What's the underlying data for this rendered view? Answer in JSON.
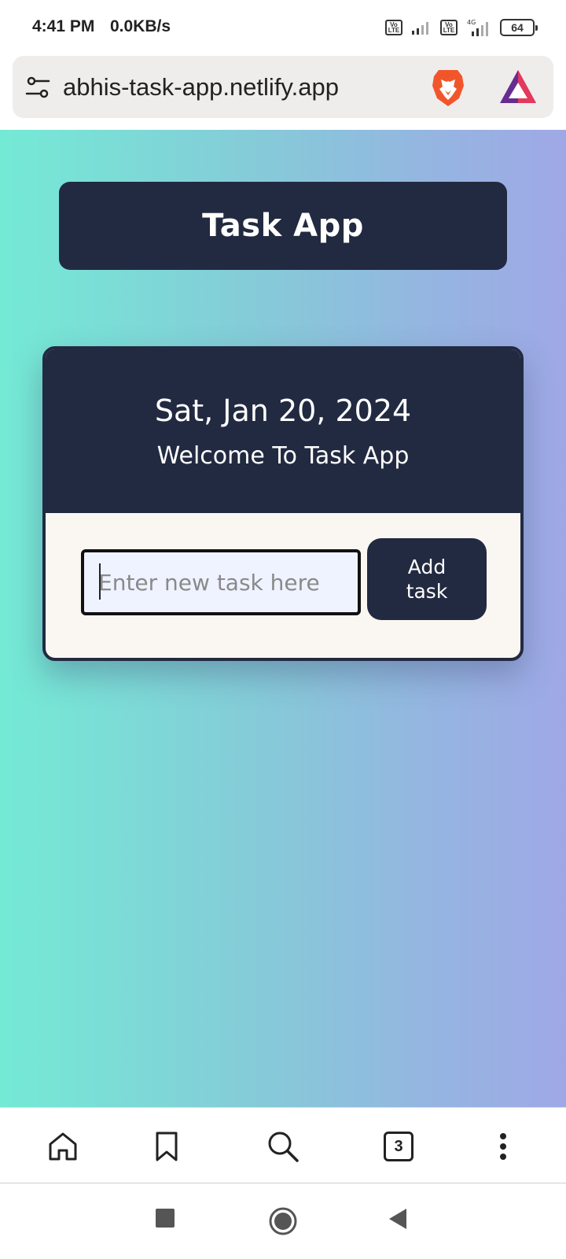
{
  "status_bar": {
    "time": "4:41 PM",
    "network_speed": "0.0KB/s",
    "sim1_label": "Vo LTE",
    "sim2_label": "Vo LTE",
    "network_type": "4G",
    "battery_level": "64"
  },
  "browser": {
    "url": "abhis-task-app.netlify.app",
    "open_tabs_count": "3"
  },
  "app": {
    "title": "Task App",
    "date": "Sat, Jan 20, 2024",
    "welcome": "Welcome To Task App",
    "task_input_placeholder": "Enter new task here",
    "task_input_value": "",
    "add_button_label": "Add task"
  },
  "colors": {
    "navy": "#222a41",
    "card_body": "#faf6f1",
    "input_bg": "#eef3ff",
    "gradient_start": "#74ead5",
    "gradient_end": "#9fa8e6"
  },
  "icons": {
    "site_settings": "tune-icon",
    "brave": "brave-lion-icon",
    "rewards": "bat-triangle-icon",
    "home": "home-icon",
    "bookmarks": "bookmark-icon",
    "search": "search-icon",
    "tabs": "tabs-icon",
    "menu": "more-vertical-icon"
  }
}
